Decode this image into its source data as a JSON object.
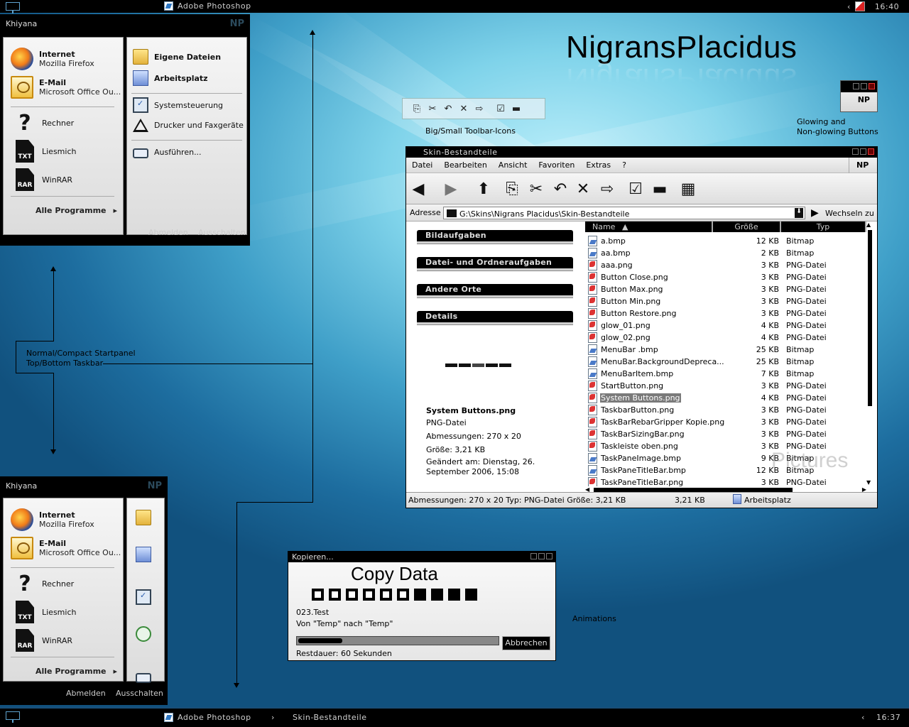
{
  "top_taskbar": {
    "app": "Adobe Photoshop",
    "clock": "16:40",
    "tray_arrow": "‹"
  },
  "bottom_taskbar": {
    "apps": [
      "Adobe Photoshop",
      "Skin-Bestandteile"
    ],
    "separator": "›",
    "clock": "16:37",
    "tray_arrow": "‹"
  },
  "start_panel": {
    "user": "Khiyana",
    "badge": "NP",
    "pinned": [
      {
        "title": "Internet",
        "subtitle": "Mozilla Firefox",
        "icon": "firefox-icon"
      },
      {
        "title": "E-Mail",
        "subtitle": "Microsoft Office Ou...",
        "icon": "outlook-icon"
      }
    ],
    "recent": [
      {
        "label": "Rechner",
        "icon": "question-icon",
        "glyph": "?"
      },
      {
        "label": "Liesmich",
        "icon": "txt-file-icon",
        "glyph": "TXT"
      },
      {
        "label": "WinRAR",
        "icon": "rar-file-icon",
        "glyph": "RAR"
      }
    ],
    "all_programs": "Alle Programme",
    "places_bold": [
      "Eigene Dateien",
      "Arbeitsplatz"
    ],
    "places": [
      "Systemsteuerung",
      "Drucker und Faxgeräte"
    ],
    "run": "Ausführen...",
    "logoff": "Abmelden",
    "shutdown": "Ausschalten"
  },
  "captions": {
    "startpanel_line1": "Normal/Compact Startpanel",
    "startpanel_line2": "Top/Bottom Taskbar",
    "toolbar_icons": "Big/Small Toolbar-Icons",
    "buttons_line1": "Glowing and",
    "buttons_line2": "Non-glowing Buttons",
    "animations": "Animations"
  },
  "theme_title": "NigransPlacidus",
  "np_badge": "NP",
  "explorer": {
    "title": "Skin-Bestandteile",
    "menu": [
      "Datei",
      "Bearbeiten",
      "Ansicht",
      "Favoriten",
      "Extras",
      "?"
    ],
    "np": "NP",
    "address_label": "Adresse",
    "address": "G:\\Skins\\Nigrans Placidus\\Skin-Bestandteile",
    "go": "Wechseln zu",
    "taskpane_heads": [
      "Bildaufgaben",
      "Datei- und Ordneraufgaben",
      "Andere Orte",
      "Details"
    ],
    "details": {
      "name": "System Buttons.png",
      "type": "PNG-Datei",
      "dims": "Abmessungen: 270 x 20",
      "size": "Größe: 3,21 KB",
      "changed": "Geändert am: Dienstag, 26. September 2006, 15:08"
    },
    "columns": [
      "Name",
      "Größe",
      "Typ"
    ],
    "files": [
      {
        "name": "a.bmp",
        "size": "12 KB",
        "type": "Bitmap",
        "kind": "bmp"
      },
      {
        "name": "aa.bmp",
        "size": "2 KB",
        "type": "Bitmap",
        "kind": "bmp"
      },
      {
        "name": "aaa.png",
        "size": "3 KB",
        "type": "PNG-Datei",
        "kind": "png"
      },
      {
        "name": "Button Close.png",
        "size": "3 KB",
        "type": "PNG-Datei",
        "kind": "png"
      },
      {
        "name": "Button Max.png",
        "size": "3 KB",
        "type": "PNG-Datei",
        "kind": "png"
      },
      {
        "name": "Button Min.png",
        "size": "3 KB",
        "type": "PNG-Datei",
        "kind": "png"
      },
      {
        "name": "Button Restore.png",
        "size": "3 KB",
        "type": "PNG-Datei",
        "kind": "png"
      },
      {
        "name": "glow_01.png",
        "size": "4 KB",
        "type": "PNG-Datei",
        "kind": "png"
      },
      {
        "name": "glow_02.png",
        "size": "4 KB",
        "type": "PNG-Datei",
        "kind": "png"
      },
      {
        "name": "MenuBar .bmp",
        "size": "25 KB",
        "type": "Bitmap",
        "kind": "bmp"
      },
      {
        "name": "MenuBar.BackgroundDepreca...",
        "size": "25 KB",
        "type": "Bitmap",
        "kind": "bmp"
      },
      {
        "name": "MenuBarItem.bmp",
        "size": "7 KB",
        "type": "Bitmap",
        "kind": "bmp"
      },
      {
        "name": "StartButton.png",
        "size": "3 KB",
        "type": "PNG-Datei",
        "kind": "png"
      },
      {
        "name": "System Buttons.png",
        "size": "4 KB",
        "type": "PNG-Datei",
        "kind": "png",
        "selected": true
      },
      {
        "name": "TaskbarButton.png",
        "size": "3 KB",
        "type": "PNG-Datei",
        "kind": "png"
      },
      {
        "name": "TaskBarRebarGripper Kopie.png",
        "size": "3 KB",
        "type": "PNG-Datei",
        "kind": "png"
      },
      {
        "name": "TaskBarSizingBar.png",
        "size": "3 KB",
        "type": "PNG-Datei",
        "kind": "png"
      },
      {
        "name": "Taskleiste oben.png",
        "size": "3 KB",
        "type": "PNG-Datei",
        "kind": "png"
      },
      {
        "name": "TaskPaneImage.bmp",
        "size": "9 KB",
        "type": "Bitmap",
        "kind": "bmp"
      },
      {
        "name": "TaskPaneTitleBar.bmp",
        "size": "12 KB",
        "type": "Bitmap",
        "kind": "bmp"
      },
      {
        "name": "TaskPaneTitleBar.png",
        "size": "3 KB",
        "type": "PNG-Datei",
        "kind": "png"
      }
    ],
    "watermark": "Pictures",
    "status_info": "Abmessungen: 270 x 20 Typ: PNG-Datei Größe: 3,21 KB",
    "status_size": "3,21 KB",
    "status_zone": "Arbeitsplatz"
  },
  "copy_dialog": {
    "title": "Kopieren...",
    "heading": "Copy Data",
    "file": "023.Test",
    "from_to": "Von \"Temp\" nach \"Temp\"",
    "cancel": "Abbrechen",
    "remaining": "Restdauer: 60 Sekunden",
    "progress": 0.11,
    "squares_total": 10,
    "squares_filled": 4
  },
  "colors": {
    "accent": "#1a4f78",
    "chrome": "#000000",
    "selection": "#7a7a7a"
  }
}
